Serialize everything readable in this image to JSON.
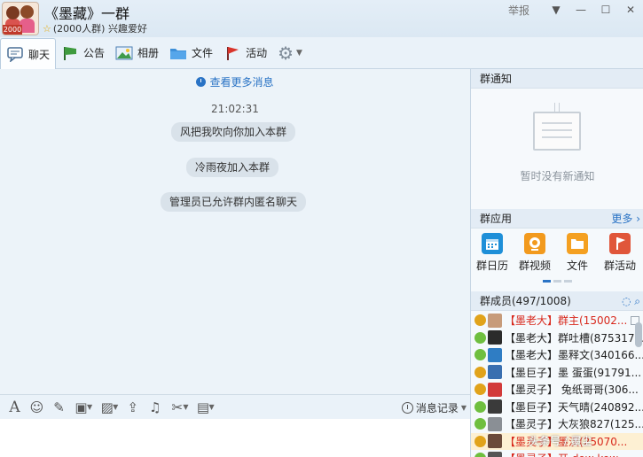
{
  "header": {
    "group_name": "《墨藏》一群",
    "group_size": "(2000人群)",
    "group_tag": "兴趣爱好",
    "avatar_badge": "2000",
    "report_label": "举报"
  },
  "toolbar": {
    "tabs": [
      {
        "label": "聊天",
        "icon": "chat-bubble-icon"
      },
      {
        "label": "公告",
        "icon": "announcement-flag-icon"
      },
      {
        "label": "相册",
        "icon": "photo-album-icon"
      },
      {
        "label": "文件",
        "icon": "folder-icon"
      },
      {
        "label": "活动",
        "icon": "activity-flag-icon"
      }
    ]
  },
  "chat": {
    "more_messages": "查看更多消息",
    "timestamp": "21:02:31",
    "system_messages": [
      "风把我吹向你加入本群",
      "冷雨夜加入本群",
      "管理员已允许群内匿名聊天"
    ]
  },
  "input": {
    "history_label": "消息记录"
  },
  "sidebar": {
    "notice_title": "群通知",
    "notice_empty": "暂时没有新通知",
    "apps_title": "群应用",
    "apps_more": "更多",
    "apps": [
      {
        "label": "群日历",
        "icon": "calendar-icon",
        "color": "#1e8fd8"
      },
      {
        "label": "群视频",
        "icon": "video-icon",
        "color": "#f29a1e"
      },
      {
        "label": "文件",
        "icon": "folder-icon",
        "color": "#f4a021"
      },
      {
        "label": "群活动",
        "icon": "activity-icon",
        "color": "#e0563a"
      }
    ],
    "members_title": "群成员(497/1008)",
    "members": [
      {
        "name": "【墨老大】群主(15002...",
        "status": "busy",
        "red": true,
        "avatar": "#c79b7a"
      },
      {
        "name": "【墨老大】群吐槽(875317...",
        "status": "online",
        "red": false,
        "avatar": "#2b2b2b"
      },
      {
        "name": "【墨老大】墨释文(340166...",
        "status": "online",
        "red": false,
        "avatar": "#2f7dc4"
      },
      {
        "name": "【墨巨子】墨  蛋蛋(91791...",
        "status": "busy",
        "red": false,
        "avatar": "#3a6fb0"
      },
      {
        "name": "【墨灵子】 兔纸哥哥(306...",
        "status": "busy",
        "red": false,
        "avatar": "#d23a3a"
      },
      {
        "name": "【墨巨子】天气晴(240892...",
        "status": "online",
        "red": false,
        "avatar": "#3a3a3a"
      },
      {
        "name": "【墨灵子】大灰狼827(125...",
        "status": "online",
        "red": false,
        "avatar": "#8a8f95"
      },
      {
        "name": "【墨灵子】墨汉(25070...",
        "status": "busy",
        "red": true,
        "avatar": "#6b4a3a"
      },
      {
        "name": "【墨灵子】开 dow kow",
        "status": "online",
        "red": true,
        "avatar": "#555555"
      }
    ]
  }
}
